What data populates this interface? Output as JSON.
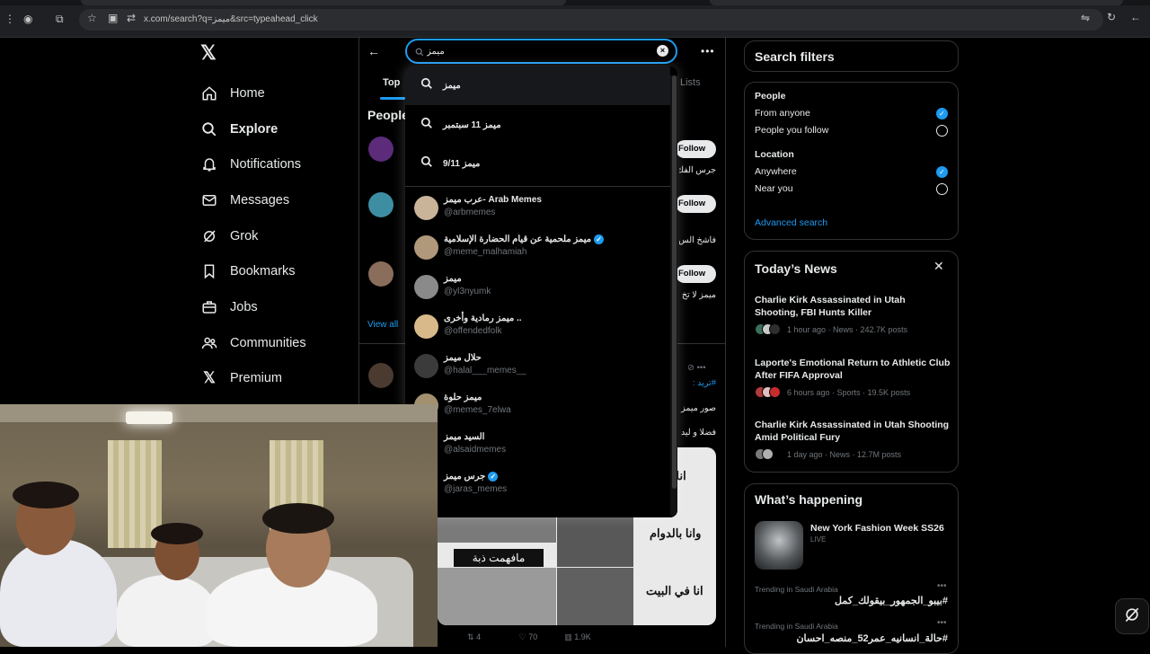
{
  "browser": {
    "url": "x.com/search?q=ميمز&src=typeahead_click"
  },
  "nav": {
    "items": [
      {
        "label": "Home",
        "icon": "home-icon"
      },
      {
        "label": "Explore",
        "icon": "search-icon"
      },
      {
        "label": "Notifications",
        "icon": "bell-icon"
      },
      {
        "label": "Messages",
        "icon": "mail-icon"
      },
      {
        "label": "Grok",
        "icon": "grok-icon"
      },
      {
        "label": "Bookmarks",
        "icon": "bookmark-icon"
      },
      {
        "label": "Jobs",
        "icon": "briefcase-icon"
      },
      {
        "label": "Communities",
        "icon": "communities-icon"
      },
      {
        "label": "Premium",
        "icon": "x-logo-icon"
      }
    ]
  },
  "search": {
    "value": "ميمز"
  },
  "tabs": {
    "top": "Top",
    "lists": "Lists"
  },
  "people_heading": "People",
  "follow_label": "Follow",
  "view_all": "View all",
  "background_snippets": {
    "s1": "جرس الفك",
    "s2": "فاشخ الس",
    "s3": "ميمز لا تخ",
    "s4": "#تريد :",
    "s5": "صور ميمز",
    "s6": "فضلا و ليد"
  },
  "dropdown": {
    "queries": [
      {
        "label": "ميمز"
      },
      {
        "label": "ميمز 11 سبتمبر"
      },
      {
        "label": "ميمز 9/11"
      }
    ],
    "users": [
      {
        "name": "عرب ميمز- Arab Memes",
        "handle": "@arbmemes",
        "verified": false,
        "color": "#c9b49a"
      },
      {
        "name": "ميمز ملحمية عن قيام الحضارة الإسلامية",
        "handle": "@meme_malhamiah",
        "verified": true,
        "color": "#b0987a"
      },
      {
        "name": "ميمز",
        "handle": "@yl3nyumk",
        "verified": false,
        "color": "#8a8a8a"
      },
      {
        "name": "ميمز رمادية وأخرى ..",
        "handle": "@offendedfolk",
        "verified": false,
        "color": "#d8b98a"
      },
      {
        "name": "حلال ميمز",
        "handle": "@halal___memes__",
        "verified": false,
        "color": "#3b3b3b"
      },
      {
        "name": "ميمز حلوة",
        "handle": "@memes_7elwa",
        "verified": false,
        "color": "#a2906f"
      },
      {
        "name": "السيد ميمز",
        "handle": "@alsaidmemes",
        "verified": false,
        "color": "#000000"
      },
      {
        "name": "جرس ميمز",
        "handle": "@jaras_memes",
        "verified": true,
        "color": "#000000"
      }
    ]
  },
  "search_filters": {
    "title": "Search filters",
    "people_label": "People",
    "from_anyone": "From anyone",
    "people_you_follow": "People you follow",
    "location_label": "Location",
    "anywhere": "Anywhere",
    "near_you": "Near you",
    "advanced": "Advanced search"
  },
  "todays_news": {
    "title": "Today’s News",
    "items": [
      {
        "headline": "Charlie Kirk Assassinated in Utah Shooting, FBI Hunts Killer",
        "meta": "1 hour ago · News · 242.7K posts"
      },
      {
        "headline": "Laporte's Emotional Return to Athletic Club After FIFA Approval",
        "meta": "6 hours ago · Sports · 19.5K posts"
      },
      {
        "headline": "Charlie Kirk Assassinated in Utah Shooting Amid Political Fury",
        "meta": "1 day ago · News · 12.7M posts"
      }
    ]
  },
  "whats_happening": {
    "title": "What’s happening",
    "event_title": "New York Fashion Week SS26",
    "event_status": "LIVE",
    "trends": [
      {
        "context": "Trending in Saudi Arabia",
        "name": "#بيبو_الجمهور_بيقولك_كمل"
      },
      {
        "context": "Trending in Saudi Arabia",
        "name": "#حالة_انسانيه_عمر52_منصه_احسان"
      }
    ]
  },
  "post": {
    "caption": "مافهمت ذبة",
    "meme_lines": [
      "انا رايح",
      "وانا بالدوام",
      "انا في البيت"
    ],
    "retweets": "4",
    "likes": "70",
    "views": "1.9K"
  }
}
